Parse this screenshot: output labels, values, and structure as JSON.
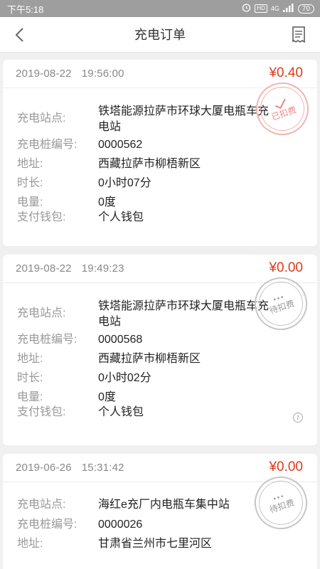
{
  "status_bar": {
    "time": "下午5:18",
    "network": "4G",
    "hd": "HD",
    "battery": "70"
  },
  "header": {
    "title": "充电订单"
  },
  "labels": {
    "station": "充电站点:",
    "pile": "充电桩编号:",
    "address": "地址:",
    "duration": "时长:",
    "energy": "电量:",
    "wallet": "支付钱包:"
  },
  "orders": [
    {
      "date": "2019-08-22",
      "time": "19:56:00",
      "price": "¥0.40",
      "station_line1": "铁塔能源拉萨市环球大厦电瓶车充",
      "station_line2": "电站",
      "pile": "0000562",
      "address": "西藏拉萨市柳梧新区",
      "duration": "0小时07分",
      "energy": "0度",
      "wallet": "个人钱包",
      "stamp": "已扣费"
    },
    {
      "date": "2019-08-22",
      "time": "19:49:23",
      "price": "¥0.00",
      "station_line1": "铁塔能源拉萨市环球大厦电瓶车充",
      "station_line2": "电站",
      "pile": "0000568",
      "address": "西藏拉萨市柳梧新区",
      "duration": "0小时02分",
      "energy": "0度",
      "wallet": "个人钱包",
      "stamp": "待扣费"
    },
    {
      "date": "2019-06-26",
      "time": "15:31:42",
      "price": "¥0.00",
      "station_line1": "海红e充厂内电瓶车集中站",
      "pile": "0000026",
      "address": "甘肃省兰州市七里河区",
      "stamp": "待扣费"
    }
  ],
  "colors": {
    "price": "#e23a1a",
    "statusbar": "#9e9e9e",
    "background": "#f0f0f0"
  }
}
